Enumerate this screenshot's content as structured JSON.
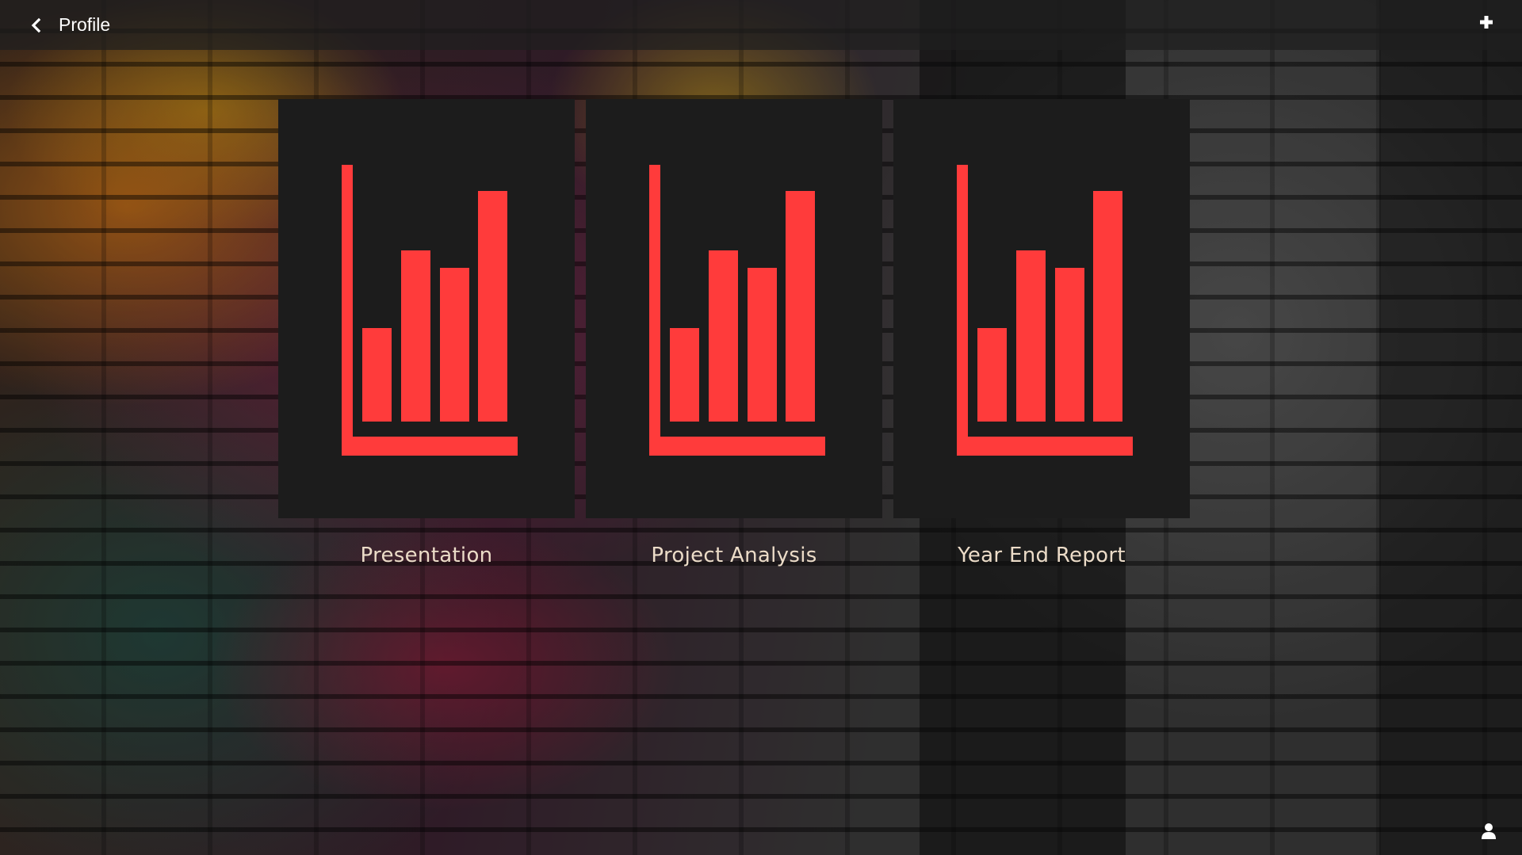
{
  "header": {
    "back_label": "Profile"
  },
  "icons": {
    "back": "chevron-left-icon",
    "add": "plus-icon",
    "user": "user-icon",
    "card": "bar-chart-icon"
  },
  "colors": {
    "accent": "#ff3b3b",
    "tile": "#1c1c1c",
    "label": "#ecdcc8"
  },
  "cards": [
    {
      "label": "Presentation"
    },
    {
      "label": "Project Analysis"
    },
    {
      "label": "Year End Report"
    }
  ]
}
